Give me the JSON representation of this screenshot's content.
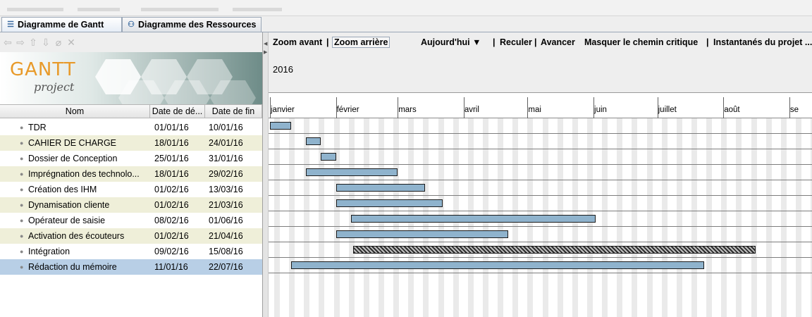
{
  "tabs": [
    {
      "label": "Diagramme de Gantt",
      "icon": "gantt-icon"
    },
    {
      "label": "Diagramme des Ressources",
      "icon": "resources-icon"
    }
  ],
  "left_toolbar_icons": [
    "arrow-left-icon",
    "arrow-right-icon",
    "arrow-up-icon",
    "arrow-down-icon",
    "link-icon",
    "unlink-icon"
  ],
  "logo": {
    "text_main": "GANTT",
    "text_sub": "project"
  },
  "columns": {
    "name": "Nom",
    "start": "Date de dé...",
    "end": "Date de fin"
  },
  "tasks": [
    {
      "name": "TDR",
      "start": "01/01/16",
      "end": "10/01/16"
    },
    {
      "name": "CAHIER DE CHARGE",
      "start": "18/01/16",
      "end": "24/01/16"
    },
    {
      "name": "Dossier de Conception",
      "start": "25/01/16",
      "end": "31/01/16"
    },
    {
      "name": "Imprégnation des technolo...",
      "start": "18/01/16",
      "end": "29/02/16"
    },
    {
      "name": "Création des IHM",
      "start": "01/02/16",
      "end": "13/03/16"
    },
    {
      "name": "Dynamisation cliente",
      "start": "01/02/16",
      "end": "21/03/16"
    },
    {
      "name": "Opérateur de saisie",
      "start": "08/02/16",
      "end": "01/06/16"
    },
    {
      "name": "Activation des écouteurs",
      "start": "01/02/16",
      "end": "21/04/16"
    },
    {
      "name": "Intégration",
      "start": "09/02/16",
      "end": "15/08/16",
      "critical": true
    },
    {
      "name": "Rédaction du mémoire",
      "start": "11/01/16",
      "end": "22/07/16",
      "selected": true
    }
  ],
  "toolbar": {
    "zoom_in": "Zoom avant",
    "sep1": "|",
    "zoom_out": "Zoom arrière",
    "today": "Aujourd'hui ▼",
    "sep2": "|",
    "back": "Reculer",
    "sep3": "|",
    "forward": "Avancer",
    "critical_path": "Masquer le chemin critique",
    "sep4": "|",
    "snapshots": "Instantanés du projet ..."
  },
  "year": "2016",
  "months": [
    "janvier",
    "février",
    "mars",
    "avril",
    "mai",
    "juin",
    "juillet",
    "août",
    "se"
  ]
}
